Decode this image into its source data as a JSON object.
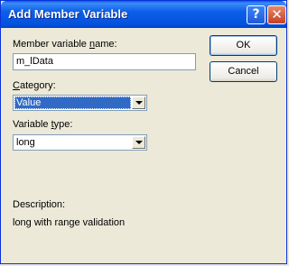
{
  "window": {
    "title": "Add Member Variable",
    "help_icon": "question-mark",
    "close_icon": "x-mark"
  },
  "member_name": {
    "label_pre": "Member variable ",
    "label_ul": "n",
    "label_post": "ame:",
    "value": "m_lData"
  },
  "category": {
    "label_pre": "",
    "label_ul": "C",
    "label_post": "ategory:",
    "value": "Value"
  },
  "variable_type": {
    "label_pre": "Variable ",
    "label_ul": "t",
    "label_post": "ype:",
    "value": "long"
  },
  "buttons": {
    "ok": "OK",
    "cancel": "Cancel"
  },
  "description": {
    "label": "Description:",
    "text": "long with range validation"
  }
}
